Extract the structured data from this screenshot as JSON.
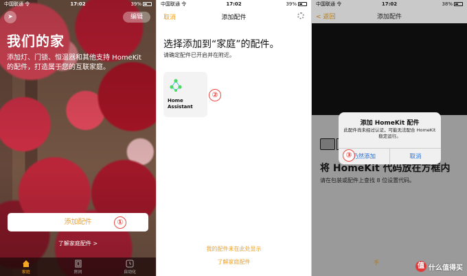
{
  "panel1": {
    "status": {
      "carrier": "中国联通 令",
      "time": "17:02",
      "right": "39%"
    },
    "edit_label": "编辑",
    "title": "我们的家",
    "description": "添加灯、门锁、恒温器和其他支持 HomeKit 的配件，打造属于您的互联家庭。",
    "add_button": "添加配件",
    "learn_link": "了解家庭配件 >",
    "badge": "①",
    "tabs": [
      {
        "label": "家庭"
      },
      {
        "label": "房间"
      },
      {
        "label": "自动化"
      }
    ]
  },
  "panel2": {
    "status": {
      "carrier": "中国联通 令",
      "time": "17:02",
      "right": "39%"
    },
    "cancel": "取消",
    "nav_title": "添加配件",
    "heading": "选择添加到“家庭”的配件。",
    "subheading": "请确定配件已开启并在附近。",
    "accessory": {
      "line1": "Home",
      "line2": "Assistant"
    },
    "badge": "②",
    "link1": "我的配件未在此处显示",
    "link2": "了解家庭配件"
  },
  "panel3": {
    "status": {
      "carrier": "中国联通 令",
      "time": "17:02",
      "right": "38%"
    },
    "back": "< 返回",
    "nav_title": "添加配件",
    "alert": {
      "title": "添加 HomeKit 配件",
      "message": "此配件尚未经过认证，可能无法配合 HomeKit 稳定运行。",
      "confirm": "仍然添加",
      "cancel": "取消"
    },
    "badge": "③",
    "big_title": "将 HomeKit 代码放在方框内",
    "hint": "请在包装或配件上查找 8 位设置代码。",
    "manual_link": "手"
  },
  "watermark": {
    "logo": "值",
    "text": "什么值得买"
  }
}
